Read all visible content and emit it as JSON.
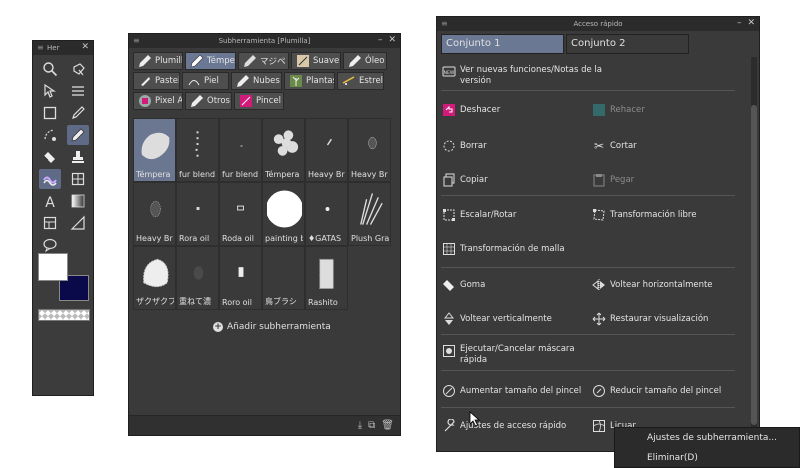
{
  "tool_palette": {
    "title": "Her"
  },
  "subtool": {
    "title": "Subherramienta [Plumilla]",
    "groups": [
      {
        "label": "Plumilla",
        "icon": "pen-icon"
      },
      {
        "label": "Témpe",
        "icon": "tempera-brush-icon"
      },
      {
        "label": "マジペ",
        "icon": "marker-icon"
      },
      {
        "label": "Suave",
        "icon": "soft-brush-icon"
      },
      {
        "label": "Óleo",
        "icon": "oil-brush-icon"
      },
      {
        "label": "Pastel",
        "icon": "pastel-icon"
      },
      {
        "label": "Piel",
        "icon": "skin-brush-icon"
      },
      {
        "label": "Nubes",
        "icon": "cloud-brush-icon"
      },
      {
        "label": "Plantas",
        "icon": "plant-brush-icon"
      },
      {
        "label": "Estrella",
        "icon": "star-brush-icon"
      },
      {
        "label": "Pixel Ar",
        "icon": "pixel-art-icon"
      },
      {
        "label": "Otros",
        "icon": "other-brush-icon"
      },
      {
        "label": "Pincel (",
        "icon": "custom-brush-icon"
      }
    ],
    "brushes": [
      "Témpera",
      "fur blend",
      "fur blend",
      "Témpera",
      "Heavy Br",
      "Heavy Br",
      "Heavy Br",
      "Rora oil",
      "Roda oil",
      "painting b",
      "♦GATAS",
      "Plush Gra",
      "ザクザクブ",
      "重ねて濃",
      "Roro oil",
      "鳥ブラシ",
      "Rashito"
    ],
    "add_label": "Añadir subherramienta"
  },
  "quick": {
    "title": "Acceso rápido",
    "tabs": [
      "Conjunto 1",
      "Conjunto 2"
    ],
    "items": {
      "news": "Ver nuevas funciones/Notas de la versión",
      "undo": "Deshacer",
      "redo": "Rehacer",
      "clear": "Borrar",
      "cut": "Cortar",
      "copy": "Copiar",
      "paste": "Pegar",
      "scale": "Escalar/Rotar",
      "free_transform": "Transformación libre",
      "mesh": "Transformación de malla",
      "eraser": "Goma",
      "flip_h": "Voltear horizontalmente",
      "flip_v": "Voltear verticalmente",
      "reset_view": "Restaurar visualización",
      "mask": "Ejecutar/Cancelar máscara rápida",
      "increase_brush": "Aumentar tamaño del pincel",
      "decrease_brush": "Reducir tamaño del pincel",
      "settings": "Ajustes de acceso rápido",
      "liquify": "Licuar"
    }
  },
  "context_menu": {
    "items": [
      "Ajustes de subherramienta...",
      "Eliminar(D)"
    ]
  },
  "colors": {
    "panel": "#3a3a3a",
    "accent": "#6a7894",
    "main_color": "#ffffff",
    "sub_color": "#0a0a4a"
  }
}
